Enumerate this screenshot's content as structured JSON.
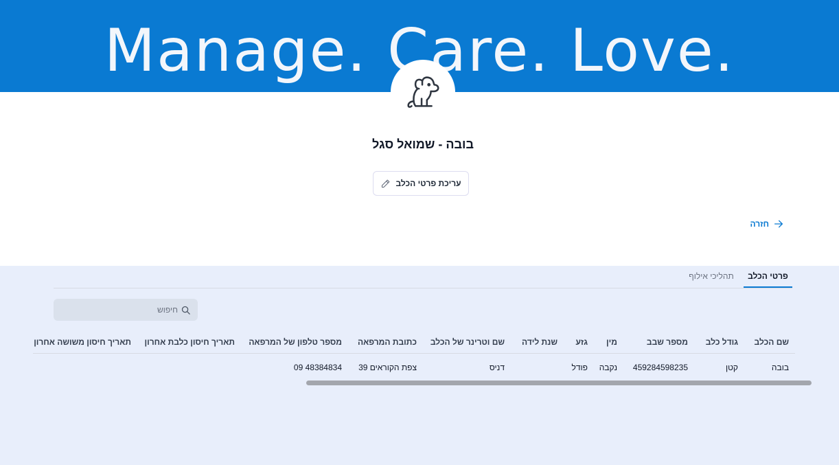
{
  "banner": {
    "text": "Manage. Care. Love."
  },
  "profile": {
    "avatar_icon": "dog-icon",
    "dog_name": "בובה - שמואל סגל",
    "edit_label": "עריכת פרטי הכלב",
    "back_label": "חזרה"
  },
  "tabs": [
    {
      "label": "פרטי הכלב",
      "active": true
    },
    {
      "label": "תהליכי אילוף",
      "active": false
    }
  ],
  "search": {
    "placeholder": "חיפוש"
  },
  "table": {
    "headers": [
      "שם הכלב",
      "גודל כלב",
      "מספר שבב",
      "מין",
      "גזע",
      "שנת לידה",
      "שם וטרינר של הכלב",
      "כתובת המרפאה",
      "מספר טלפון של המרפאה",
      "תאריך חיסון כלבת אחרון",
      "תאריך חיסון משושה אחרון"
    ],
    "rows": [
      [
        "בובה",
        "קטן",
        "459284598235",
        "נקבה",
        "פודל",
        "",
        "דניס",
        "צפת הקוראים 39",
        "09 48384834",
        "",
        ""
      ]
    ]
  },
  "colors": {
    "primary": "#0a7ad2",
    "lower_bg": "#e8eefb"
  }
}
